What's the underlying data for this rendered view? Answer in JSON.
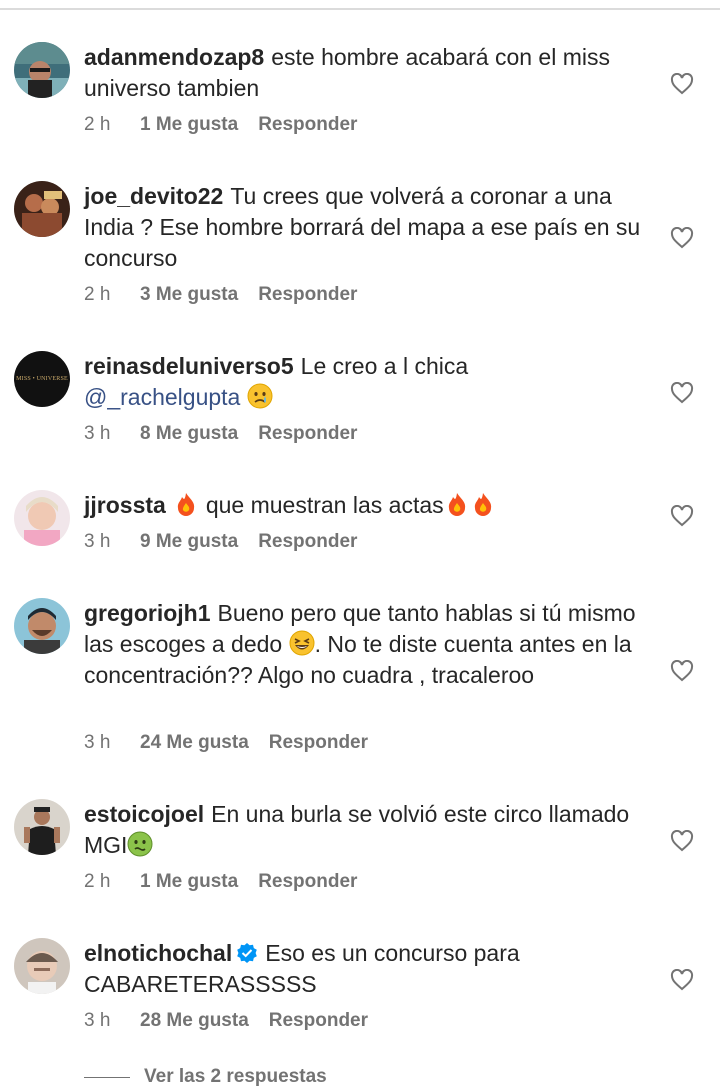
{
  "comments": [
    {
      "username": "adanmendozap8",
      "text": "este hombre acabará con el miss universo tambien",
      "time": "2 h",
      "likes": "1 Me gusta",
      "reply": "Responder"
    },
    {
      "username": "joe_devito22",
      "text": "Tu crees que volverá a coronar a una India ? Ese hombre borrará del mapa a ese país en su concurso",
      "time": "2 h",
      "likes": "3 Me gusta",
      "reply": "Responder"
    },
    {
      "username": "reinasdeluniverso5",
      "text": "Le creo a l chica",
      "mention": "@_rachelgupta",
      "avatar_text": "MISS • UNIVERSE",
      "time": "3 h",
      "likes": "8 Me gusta",
      "reply": "Responder"
    },
    {
      "username": "jjrossta",
      "text_a": "que muestran las actas",
      "time": "3 h",
      "likes": "9 Me gusta",
      "reply": "Responder"
    },
    {
      "username": "gregoriojh1",
      "text_a": "Bueno pero que tanto hablas si tú mismo las escoges a dedo",
      "text_b": ". No te diste cuenta antes en la concentración?? Algo no cuadra , tracaleroo",
      "time": "3 h",
      "likes": "24 Me gusta",
      "reply": "Responder"
    },
    {
      "username": "estoicojoel",
      "text": "En una burla se volvió este circo llamado MGI",
      "time": "2 h",
      "likes": "1 Me gusta",
      "reply": "Responder"
    },
    {
      "username": "elnotichochal",
      "text": "Eso es un concurso para CABARETERASSSSS",
      "time": "3 h",
      "likes": "28 Me gusta",
      "reply": "Responder"
    }
  ],
  "view_replies": "Ver las 2 respuestas",
  "colors": {
    "accent_link": "#385185",
    "meta": "#737373",
    "verified": "#0095f6"
  },
  "icons": {
    "heart": "heart-outline-icon",
    "fire": "fire-emoji",
    "crying": "crying-face-emoji",
    "grin": "grinning-squinting-emoji",
    "nauseated": "nauseated-face-emoji",
    "verified": "verified-badge-icon"
  }
}
